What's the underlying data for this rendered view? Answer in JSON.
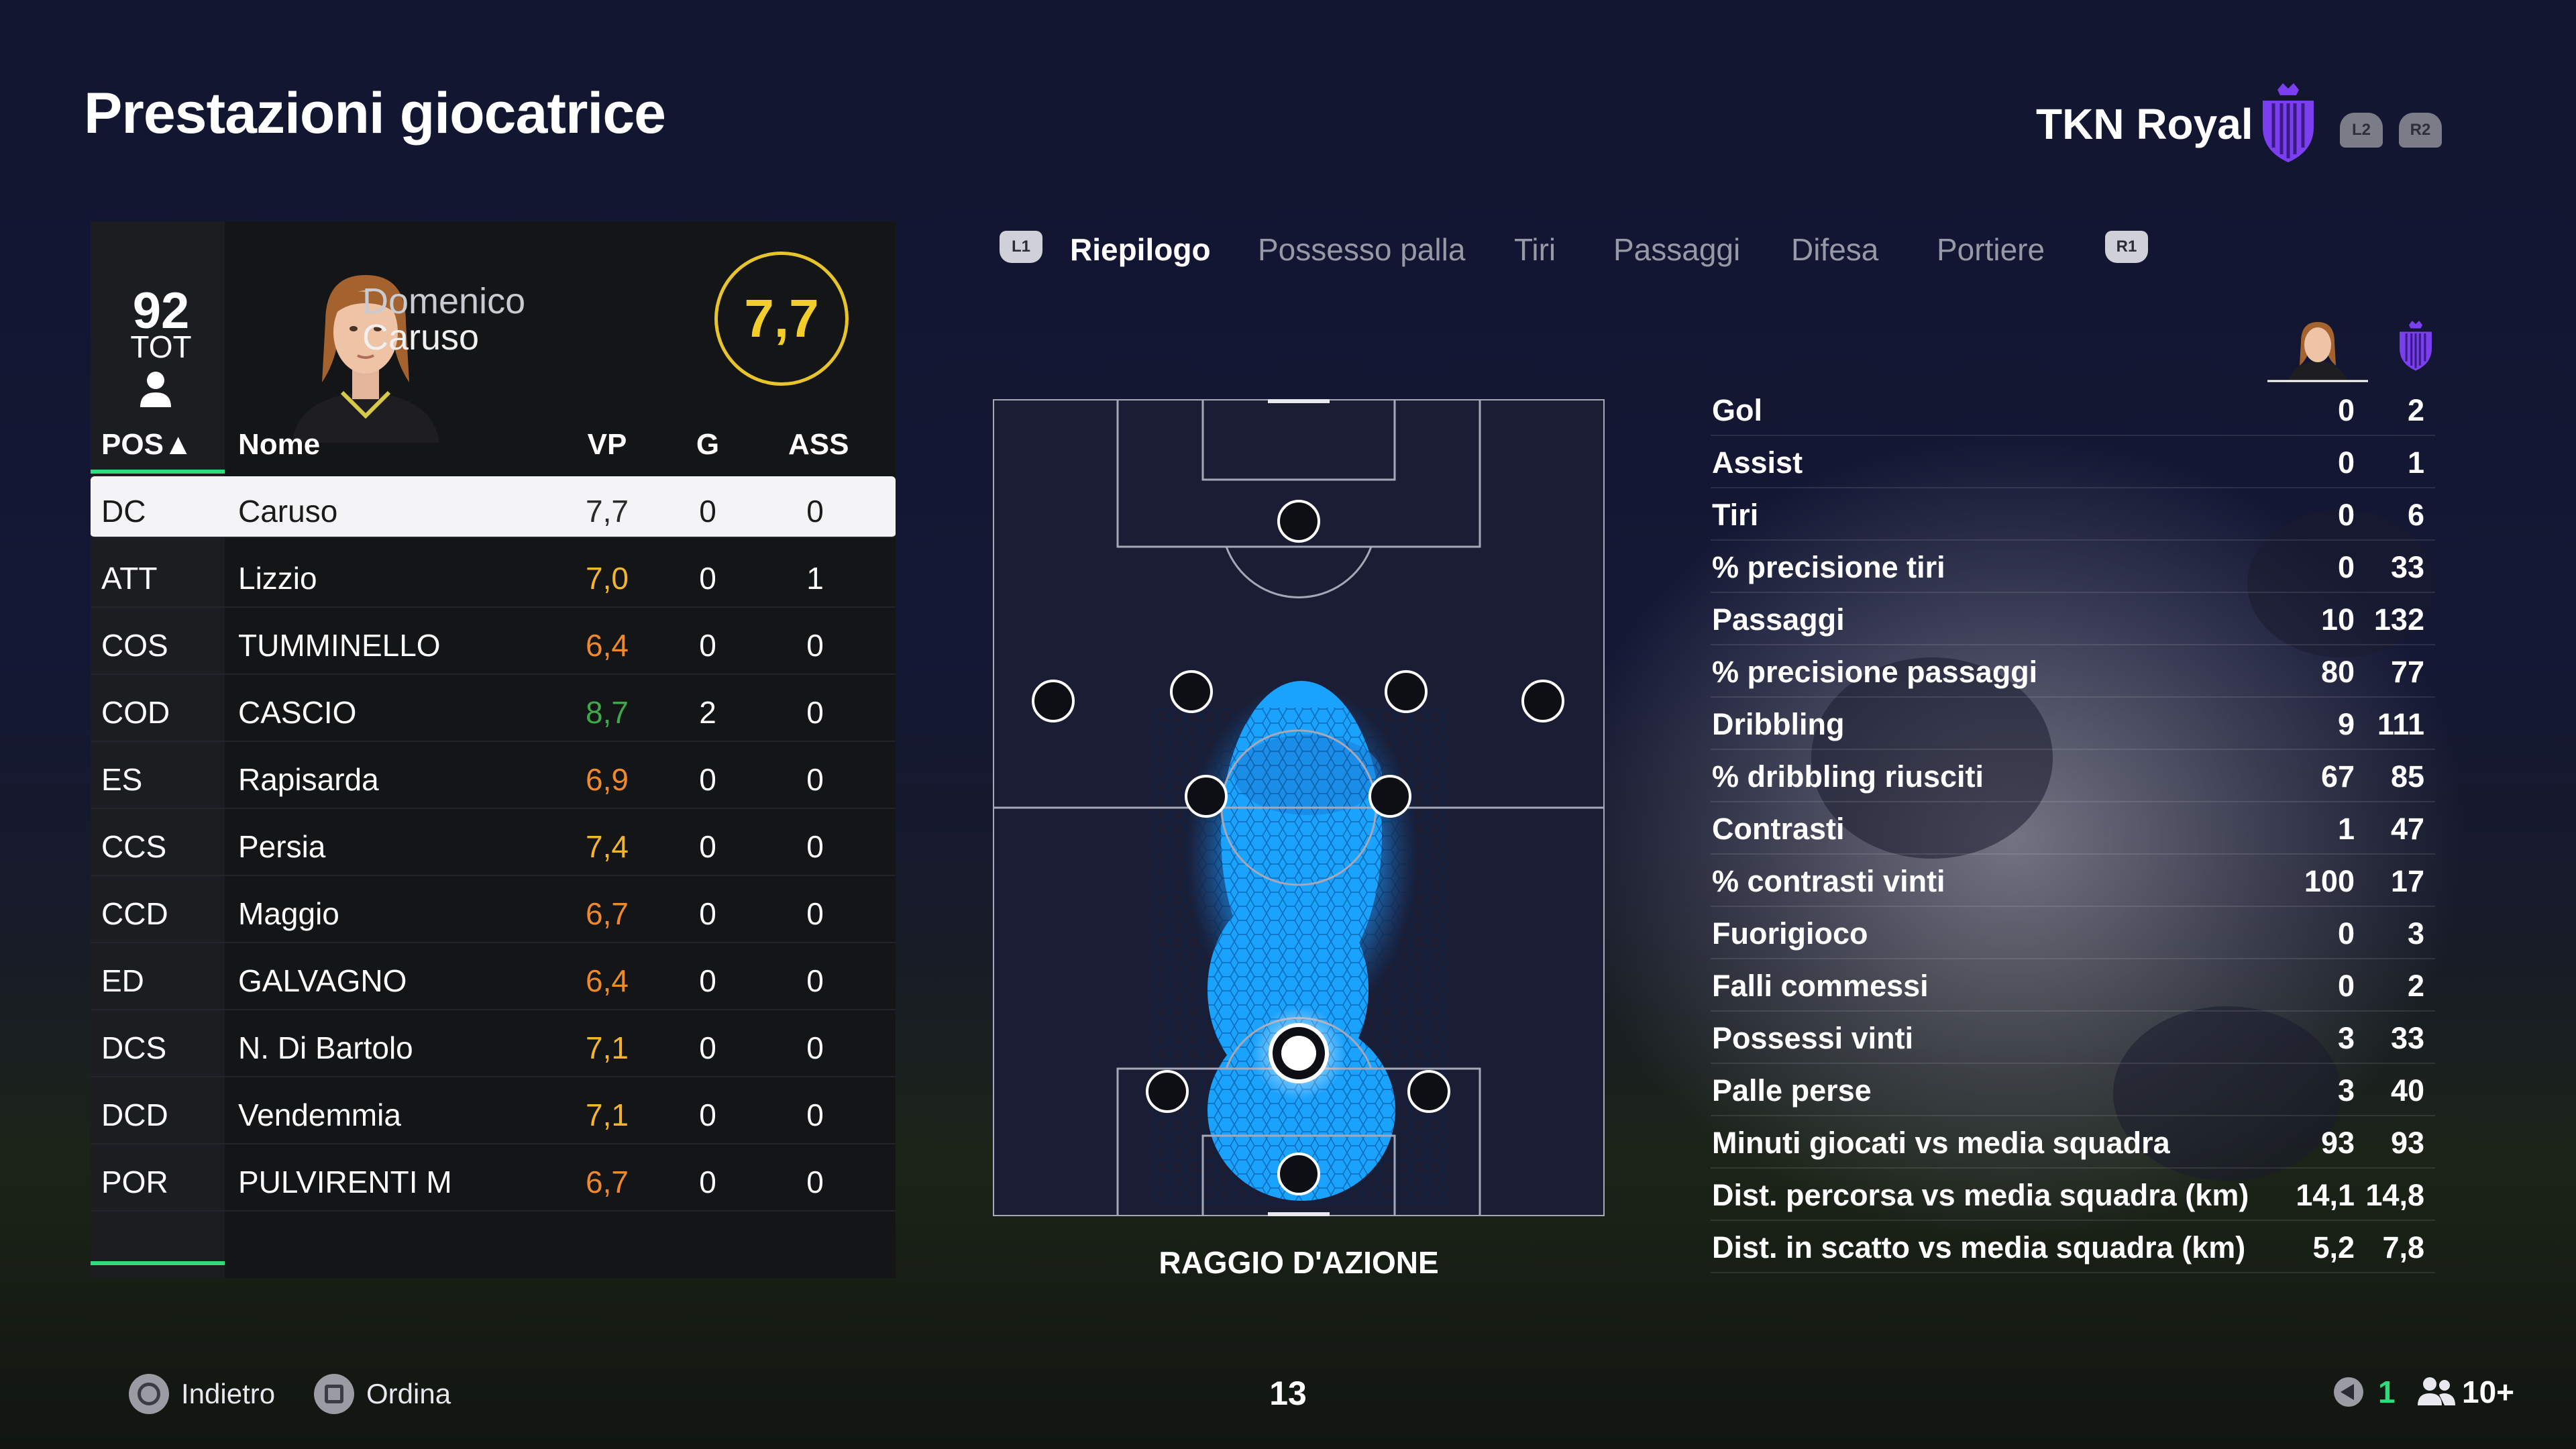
{
  "header": {
    "title": "Prestazioni giocatrice",
    "team": "TKN Royal",
    "btn_left": "L2",
    "btn_right": "R2"
  },
  "player": {
    "overall": "92",
    "overall_label": "TOT",
    "first_name": "Domenico",
    "last_name": "Caruso",
    "rating": "7,7"
  },
  "table": {
    "headers": {
      "pos": "POS▲",
      "name": "Nome",
      "vp": "VP",
      "g": "G",
      "ass": "ASS"
    },
    "rows": [
      {
        "pos": "DC",
        "name": "Caruso",
        "vp": "7,7",
        "g": "0",
        "ass": "0",
        "color": "#2a2a2a"
      },
      {
        "pos": "ATT",
        "name": "Lizzio",
        "vp": "7,0",
        "g": "0",
        "ass": "1",
        "color": "#f2b52d"
      },
      {
        "pos": "COS",
        "name": "TUMMINELLO",
        "vp": "6,4",
        "g": "0",
        "ass": "0",
        "color": "#ef8a2a"
      },
      {
        "pos": "COD",
        "name": "CASCIO",
        "vp": "8,7",
        "g": "2",
        "ass": "0",
        "color": "#3ea84a"
      },
      {
        "pos": "ES",
        "name": "Rapisarda",
        "vp": "6,9",
        "g": "0",
        "ass": "0",
        "color": "#ef8a2a"
      },
      {
        "pos": "CCS",
        "name": "Persia",
        "vp": "7,4",
        "g": "0",
        "ass": "0",
        "color": "#f2b52d"
      },
      {
        "pos": "CCD",
        "name": "Maggio",
        "vp": "6,7",
        "g": "0",
        "ass": "0",
        "color": "#ef8a2a"
      },
      {
        "pos": "ED",
        "name": "GALVAGNO",
        "vp": "6,4",
        "g": "0",
        "ass": "0",
        "color": "#ef8a2a"
      },
      {
        "pos": "DCS",
        "name": "N. Di Bartolo",
        "vp": "7,1",
        "g": "0",
        "ass": "0",
        "color": "#f2b52d"
      },
      {
        "pos": "DCD",
        "name": "Vendemmia",
        "vp": "7,1",
        "g": "0",
        "ass": "0",
        "color": "#f2b52d"
      },
      {
        "pos": "POR",
        "name": "PULVIRENTI M",
        "vp": "6,7",
        "g": "0",
        "ass": "0",
        "color": "#ef8a2a"
      }
    ]
  },
  "tabs": {
    "left_bumper": "L1",
    "right_bumper": "R1",
    "items": [
      "Riepilogo",
      "Possesso palla",
      "Tiri",
      "Passaggi",
      "Difesa",
      "Portiere"
    ]
  },
  "pitch": {
    "label": "RAGGIO D'AZIONE"
  },
  "stats": [
    {
      "label": "Gol",
      "player": "0",
      "team": "2"
    },
    {
      "label": "Assist",
      "player": "0",
      "team": "1"
    },
    {
      "label": "Tiri",
      "player": "0",
      "team": "6"
    },
    {
      "label": "% precisione tiri",
      "player": "0",
      "team": "33"
    },
    {
      "label": "Passaggi",
      "player": "10",
      "team": "132"
    },
    {
      "label": "% precisione passaggi",
      "player": "80",
      "team": "77"
    },
    {
      "label": "Dribbling",
      "player": "9",
      "team": "111"
    },
    {
      "label": "% dribbling riusciti",
      "player": "67",
      "team": "85"
    },
    {
      "label": "Contrasti",
      "player": "1",
      "team": "47"
    },
    {
      "label": "% contrasti vinti",
      "player": "100",
      "team": "17"
    },
    {
      "label": "Fuorigioco",
      "player": "0",
      "team": "3"
    },
    {
      "label": "Falli commessi",
      "player": "0",
      "team": "2"
    },
    {
      "label": "Possessi vinti",
      "player": "3",
      "team": "33"
    },
    {
      "label": "Palle perse",
      "player": "3",
      "team": "40"
    },
    {
      "label": "Minuti giocati vs media squadra",
      "player": "93",
      "team": "93"
    },
    {
      "label": "Dist. percorsa vs media squadra (km)",
      "player": "14,1",
      "team": "14,8"
    },
    {
      "label": "Dist. in scatto vs media squadra (km)",
      "player": "5,2",
      "team": "7,8"
    }
  ],
  "footer": {
    "back": "Indietro",
    "sort": "Ordina",
    "page": "13",
    "notif_count": "1",
    "friends": "10+"
  },
  "colors": {
    "accent_green": "#2fdc7d",
    "rating_yellow": "#f2cd2b",
    "heat_blue": "#1a9dff",
    "crest_purple": "#7b3ff0"
  }
}
